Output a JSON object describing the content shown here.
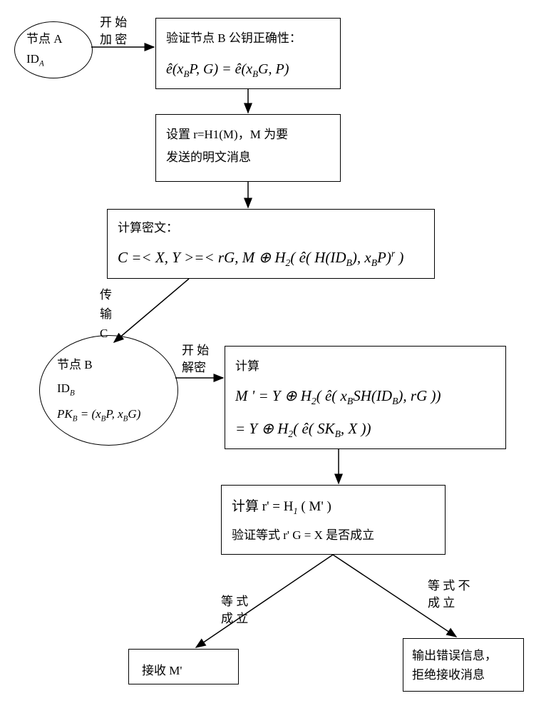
{
  "nodes": {
    "A": {
      "line1": "节点 A",
      "line2_html": "ID<span class='sub'>A</span>"
    },
    "verify": {
      "title": "验证节点 B 公钥正确性：",
      "formula_html": "ê(<i>x</i><span class='sub'>B</span><i>P</i>, <i>G</i>) = <i>ê</i>(<i>x</i><span class='sub'>B</span><i>G</i>, <i>P</i>)"
    },
    "set_r": {
      "line1": "设置 r=H1(M)，M 为要",
      "line2": "发送的明文消息"
    },
    "cipher": {
      "title": "计算密文：",
      "formula_html": "<i>C</i> =&lt; <i>X</i>, <i>Y</i> &gt;=&lt; <i>rG</i>, <i>M</i> ⊕ <i>H</i><span class='sub'>2</span>( <i>ê</i>( <i>H</i>(<i>ID</i><span class='sub'>B</span>), <i>x</i><span class='sub'>B</span><i>P</i>)<span class='sup'>r</span> )"
    },
    "B": {
      "line1": "节点 B",
      "line2_html": "ID<span class='sub'>B</span>",
      "line3_html": "<i>PK</i><span class='sub'>B</span> = (<i>x</i><span class='sub'>B</span><i>P</i>, <i>x</i><span class='sub'>B</span><i>G</i>)"
    },
    "compute_m": {
      "title": "计算",
      "formula1_html": "<i>M</i> ' = <i>Y</i> ⊕ <i>H</i><span class='sub'>2</span>( <i>ê</i>( <i>x</i><span class='sub'>B</span><i>SH</i>(<i>ID</i><span class='sub'>B</span>), <i>rG</i> ))",
      "formula2_html": "= <i>Y</i> ⊕ <i>H</i><span class='sub'>2</span>( <i>ê</i>( <i>SK</i><span class='sub'>B</span>, <i>X</i> ))"
    },
    "verify_r": {
      "line1_html": "计算 r' = H<span class='sub'>1</span> ( M' )",
      "line2": "验证等式 r' G = X 是否成立"
    },
    "accept": {
      "text": "接收 M'"
    },
    "reject": {
      "line1": "输出错误信息，",
      "line2": "拒绝接收消息"
    }
  },
  "labels": {
    "start_encrypt": "开 始\n加 密",
    "transmit_c": "传\n输\nC",
    "start_decrypt": "开 始\n解密",
    "eq_true": "等 式\n成 立",
    "eq_false": "等 式 不\n成 立"
  },
  "chart_data": {
    "type": "flowchart",
    "nodes": [
      {
        "id": "A",
        "shape": "ellipse",
        "text": "节点 A / ID_A"
      },
      {
        "id": "verify",
        "shape": "rect",
        "text": "验证节点 B 公钥正确性： ê(x_B P, G) = ê(x_B G, P)"
      },
      {
        "id": "set_r",
        "shape": "rect",
        "text": "设置 r=H1(M)，M 为要发送的明文消息"
      },
      {
        "id": "cipher",
        "shape": "rect",
        "text": "计算密文： C = <X,Y> = < rG, M ⊕ H2( ê(H(ID_B), x_B P)^r ) >"
      },
      {
        "id": "B",
        "shape": "ellipse",
        "text": "节点 B / ID_B / PK_B = (x_B P, x_B G)"
      },
      {
        "id": "compute_m",
        "shape": "rect",
        "text": "计算 M' = Y ⊕ H2( ê( x_B S H(ID_B), rG )) = Y ⊕ H2( ê( SK_B, X ))"
      },
      {
        "id": "verify_r",
        "shape": "rect",
        "text": "计算 r' = H1(M')；验证等式 r'G = X 是否成立"
      },
      {
        "id": "accept",
        "shape": "rect",
        "text": "接收 M'"
      },
      {
        "id": "reject",
        "shape": "rect",
        "text": "输出错误信息，拒绝接收消息"
      }
    ],
    "edges": [
      {
        "from": "A",
        "to": "verify",
        "label": "开始加密"
      },
      {
        "from": "verify",
        "to": "set_r"
      },
      {
        "from": "set_r",
        "to": "cipher"
      },
      {
        "from": "cipher",
        "to": "B",
        "label": "传输 C"
      },
      {
        "from": "B",
        "to": "compute_m",
        "label": "开始解密"
      },
      {
        "from": "compute_m",
        "to": "verify_r"
      },
      {
        "from": "verify_r",
        "to": "accept",
        "label": "等式成立"
      },
      {
        "from": "verify_r",
        "to": "reject",
        "label": "等式不成立"
      }
    ]
  }
}
